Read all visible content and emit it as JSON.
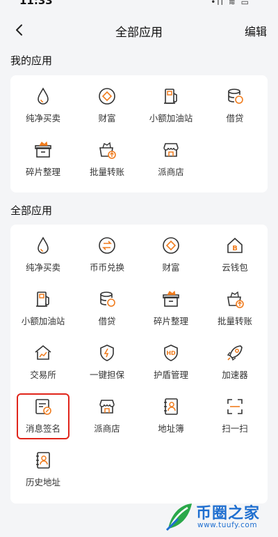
{
  "status_bar": {
    "time": "11:33",
    "icons": "•ıl ≋ ▭"
  },
  "nav": {
    "title": "全部应用",
    "edit_label": "编辑"
  },
  "my_apps": {
    "title": "我的应用",
    "items": [
      {
        "label": "纯净买卖",
        "icon": "drop-icon"
      },
      {
        "label": "财富",
        "icon": "diamond-coin-icon"
      },
      {
        "label": "小额加油站",
        "icon": "gas-station-icon"
      },
      {
        "label": "借贷",
        "icon": "coin-stack-icon"
      },
      {
        "label": "碎片整理",
        "icon": "gift-box-icon"
      },
      {
        "label": "批量转账",
        "icon": "basket-transfer-icon"
      },
      {
        "label": "派商店",
        "icon": "store-icon"
      }
    ]
  },
  "all_apps": {
    "title": "全部应用",
    "items": [
      {
        "label": "纯净买卖",
        "icon": "drop-icon"
      },
      {
        "label": "币币兑换",
        "icon": "exchange-icon"
      },
      {
        "label": "财富",
        "icon": "diamond-coin-icon"
      },
      {
        "label": "云钱包",
        "icon": "cloud-wallet-icon"
      },
      {
        "label": "小额加油站",
        "icon": "gas-station-icon"
      },
      {
        "label": "借贷",
        "icon": "coin-stack-icon"
      },
      {
        "label": "碎片整理",
        "icon": "gift-box-icon"
      },
      {
        "label": "批量转账",
        "icon": "basket-transfer-icon"
      },
      {
        "label": "交易所",
        "icon": "exchange-house-icon"
      },
      {
        "label": "一键担保",
        "icon": "shield-bolt-icon"
      },
      {
        "label": "护盾管理",
        "icon": "hd-shield-icon"
      },
      {
        "label": "加速器",
        "icon": "rocket-icon"
      },
      {
        "label": "消息签名",
        "icon": "message-sign-icon"
      },
      {
        "label": "派商店",
        "icon": "store-icon"
      },
      {
        "label": "地址簿",
        "icon": "address-book-icon"
      },
      {
        "label": "扫一扫",
        "icon": "scan-icon"
      },
      {
        "label": "历史地址",
        "icon": "history-address-icon"
      }
    ]
  },
  "watermark": {
    "title": "币圈之家",
    "url": "www.tuufy.com"
  },
  "colors": {
    "accent": "#f07c1e",
    "icon_stroke": "#333333",
    "highlight": "#e0251b",
    "watermark": "#1f6fd0"
  }
}
